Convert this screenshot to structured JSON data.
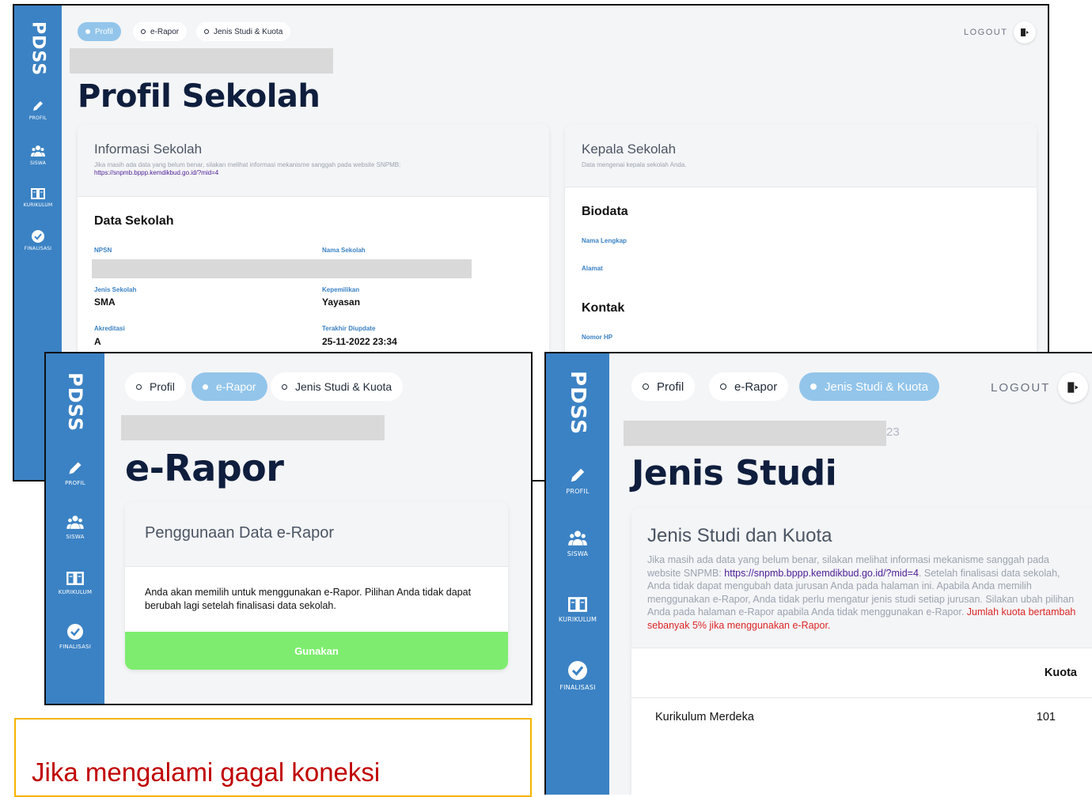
{
  "brand": "PDSS",
  "nav": {
    "profil": "PROFIL",
    "siswa": "SISWA",
    "kurikulum": "KURIKULUM",
    "finalisasi": "FINALISASI"
  },
  "tabs": {
    "profil": "Profil",
    "erapor": "e-Rapor",
    "jenis": "Jenis Studi & Kuota"
  },
  "logout": "LOGOUT",
  "profil_page": {
    "title": "Profil Sekolah",
    "info_card": {
      "title": "Informasi Sekolah",
      "desc": "Jika masih ada data yang belum benar, silakan melihat informasi mekanisme sanggah pada website SNPMB:",
      "link": "https://snpmb.bppp.kemdikbud.go.id/?mid=4",
      "section": "Data Sekolah",
      "fields": {
        "npsn_label": "NPSN",
        "nama_label": "Nama Sekolah",
        "jenis_label": "Jenis Sekolah",
        "jenis_value": "SMA",
        "kepemilikan_label": "Kepemilikan",
        "kepemilikan_value": "Yayasan",
        "akreditasi_label": "Akreditasi",
        "akreditasi_value": "A",
        "update_label": "Terakhir Diupdate",
        "update_value": "25-11-2022 23:34"
      }
    },
    "kepala_card": {
      "title": "Kepala Sekolah",
      "desc": "Data mengenai kepala sekolah Anda.",
      "biodata": "Biodata",
      "nama_label": "Nama Lengkap",
      "alamat_label": "Alamat",
      "kontak": "Kontak",
      "hp_label": "Nomor HP"
    }
  },
  "erapor_page": {
    "title": "e-Rapor",
    "card_title": "Penggunaan Data e-Rapor",
    "body": "Anda akan memilih untuk menggunakan e-Rapor. Pilihan Anda tidak dapat berubah lagi setelah finalisasi data sekolah.",
    "button": "Gunakan"
  },
  "jenis_page": {
    "subtitle_tail": "23",
    "title": "Jenis Studi",
    "card_title": "Jenis Studi dan Kuota",
    "desc_1": "Jika masih ada data yang belum benar, silakan melihat informasi mekanisme sanggah pada website SNPMB:",
    "desc_link": "https://snpmb.bppp.kemdikbud.go.id/?mid=4",
    "desc_2": ". Setelah finalisasi data sekolah, Anda tidak dapat mengubah data jurusan Anda pada halaman ini. Apabila Anda memilih menggunakan e-Rapor, Anda tidak perlu mengatur jenis studi setiap jurusan. Silakan ubah pilihan Anda pada halaman e-Rapor apabila Anda tidak menggunakan e-Rapor.",
    "desc_red": "Jumlah kuota bertambah sebanyak 5% jika menggunakan e-Rapor.",
    "table_header": "Kuota",
    "rows": [
      {
        "name": "Kurikulum Merdeka",
        "kuota": "101"
      }
    ]
  },
  "note": {
    "text": "Jika mengalami gagal koneksi"
  },
  "colors": {
    "sidebar": "#3b82c4",
    "active_tab": "#93c5ea",
    "button": "#7eed6f",
    "title": "#0f1e3d",
    "note_border": "#f4b400",
    "note_text": "#c00000"
  }
}
